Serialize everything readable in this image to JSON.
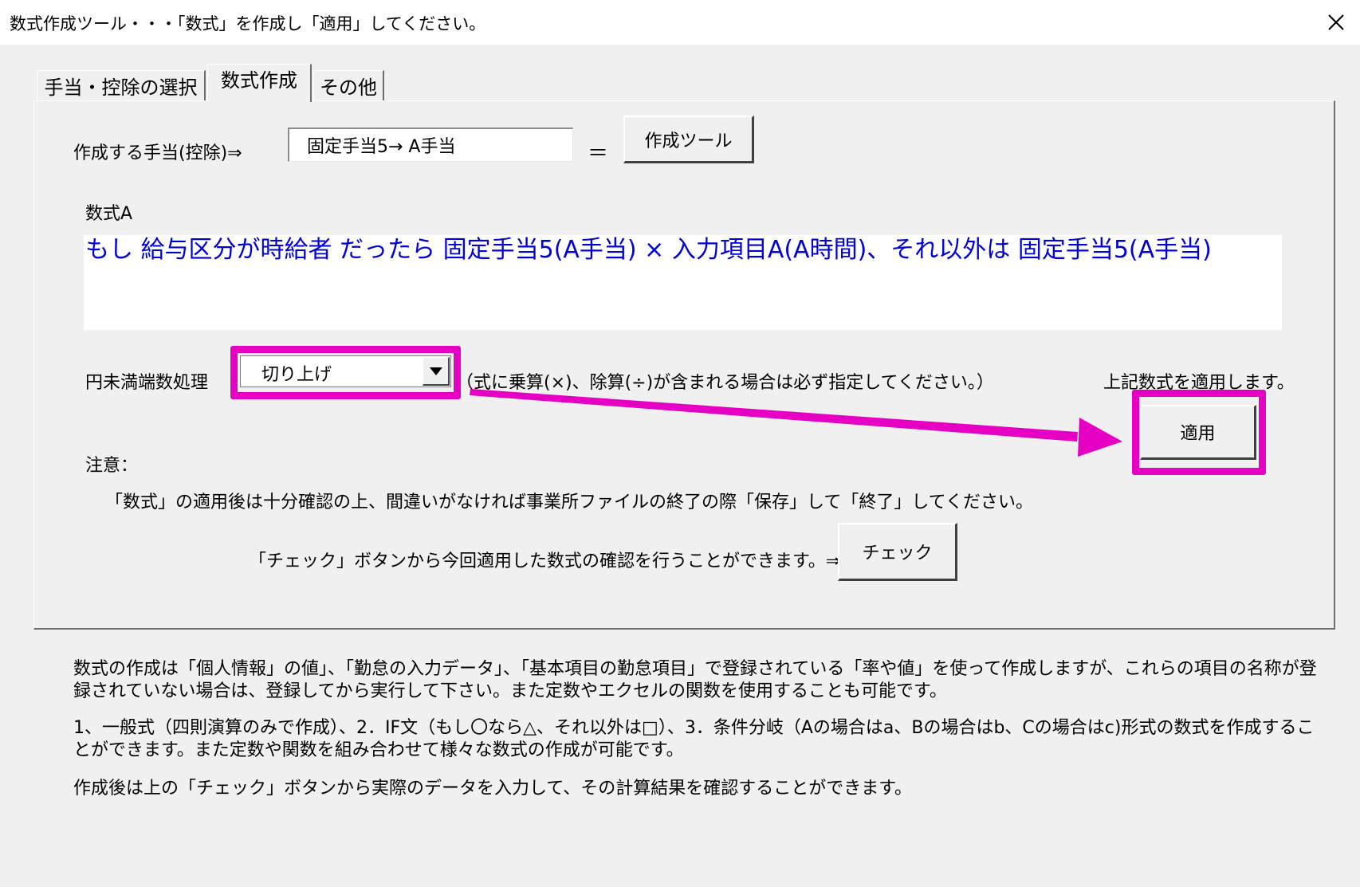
{
  "window": {
    "title": "数式作成ツール・・・「数式」を作成し「適用」してください。",
    "close_icon": "close-icon"
  },
  "tabs": [
    {
      "label": "手当・控除の選択",
      "active": false
    },
    {
      "label": "数式作成",
      "active": true
    },
    {
      "label": "その他",
      "active": false
    }
  ],
  "form": {
    "target_label": "作成する手当(控除)⇒",
    "target_value": "固定手当5→ A手当",
    "equals": "＝",
    "tool_button": "作成ツール",
    "formula_label": "数式A",
    "formula_text": "もし  給与区分が時給者 だったら  固定手当5(A手当) × 入力項目A(A時間)、それ以外は  固定手当5(A手当)",
    "rounding_label": "円未満端数処理",
    "rounding_value": "切り上げ",
    "rounding_note": "（式に乗算(×)、除算(÷)が含まれる場合は必ず指定してください。）",
    "apply_note": "上記数式を適用します。",
    "apply_button": "適用",
    "caution_label": "注意：",
    "caution_text": "「数式」の適用後は十分確認の上、間違いがなければ事業所ファイルの終了の際「保存」して「終了」してください。",
    "check_hint": "「チェック」ボタンから今回適用した数式の確認を行うことができます。⇒",
    "check_button": "チェック"
  },
  "footer": {
    "para1": "数式の作成は「個人情報」の値」、「勤怠の入力データ」、「基本項目の勤怠項目」で登録されている「率や値」を使って作成しますが、これらの項目の名称が登録されていない場合は、登録してから実行して下さい。また定数やエクセルの関数を使用することも可能です。",
    "para2": "1、一般式（四則演算のみで作成）、2．IF文（もし〇なら△、それ以外は□）、3．条件分岐（Aの場合はa、Bの場合はb、Cの場合はc)形式の数式を作成することができます。また定数や関数を組み合わせて様々な数式の作成が可能です。",
    "para3": "作成後は上の「チェック」ボタンから実際のデータを入力して、その計算結果を確認することができます。"
  },
  "colors": {
    "highlight": "#e600c4",
    "formula_text": "#0000d8",
    "background": "#f0f0f0"
  }
}
